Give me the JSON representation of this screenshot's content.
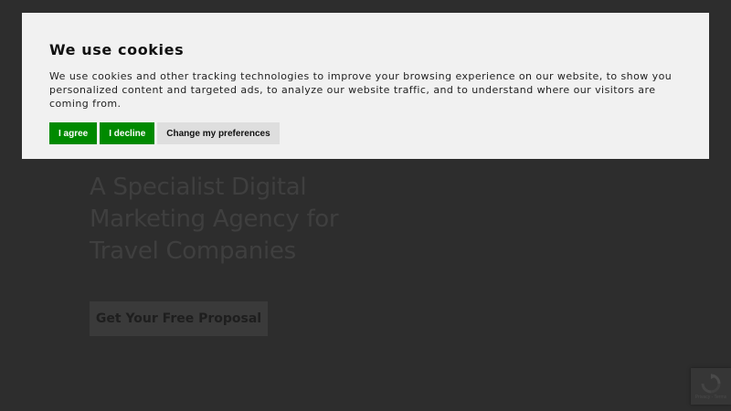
{
  "cookie_banner": {
    "title": "We use cookies",
    "text": "We use cookies and other tracking technologies to improve your browsing experience on our website, to show you personalized content and targeted ads, to analyze our website traffic, and to understand where our visitors are coming from.",
    "agree_label": "I agree",
    "decline_label": "I decline",
    "preferences_label": "Change my preferences"
  },
  "hero": {
    "title": "A Specialist Digital Marketing Agency for Travel Companies",
    "cta_label": "Get Your Free Proposal"
  },
  "recaptcha": {
    "icon": "recaptcha-icon",
    "text": "Privacy - Terms"
  },
  "colors": {
    "background": "#2d2d2d",
    "banner": "#f1f1f1",
    "accent_green": "#008a00"
  }
}
